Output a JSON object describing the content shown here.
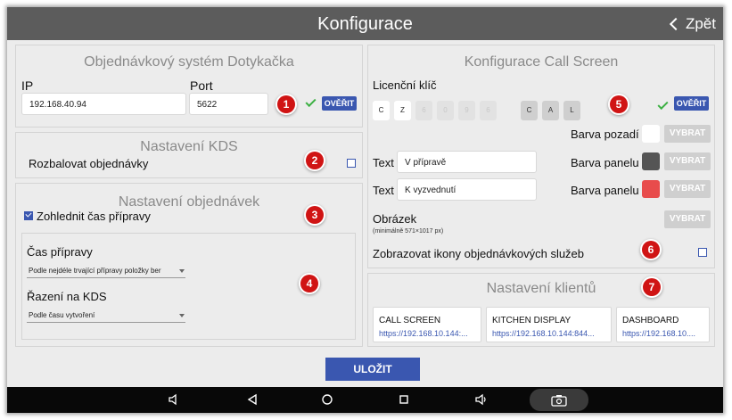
{
  "header": {
    "title": "Konfigurace",
    "back_label": "Zpět"
  },
  "dotykacka": {
    "title": "Objednávkový systém Dotykačka",
    "ip_label": "IP",
    "ip_value": "192.168.40.94",
    "port_label": "Port",
    "port_value": "5622",
    "verify_label": "OVĚŘIT",
    "badge": "1"
  },
  "kds": {
    "title": "Nastavení KDS",
    "expand_label": "Rozbalovat objednávky",
    "badge": "2"
  },
  "orders": {
    "title": "Nastavení objednávek",
    "prep_time_label": "Zohlednit čas přípravy",
    "badge": "3",
    "badge_selects": "4",
    "prep_time_select_label": "Čas přípravy",
    "prep_time_select_value": "Podle nejdéle trvající přípravy položky ber",
    "sort_label": "Řazení na KDS",
    "sort_value": "Podle času vytvoření"
  },
  "callscreen": {
    "title": "Konfigurace Call Screen",
    "license_label": "Licenční klíč",
    "license_keys": [
      "C",
      "Z",
      "6",
      "0",
      "9",
      "6",
      "C",
      "A",
      "L"
    ],
    "verify_label": "OVĚŘIT",
    "badge": "5",
    "bg_color_label": "Barva pozadí",
    "panel_color_label": "Barva panelu",
    "choose_label": "VYBRAT",
    "text_label": "Text",
    "text1_value": "V přípravě",
    "text2_value": "K vyzvednutí",
    "image_label": "Obrázek",
    "image_hint": "(minimálně 571×1017 px)",
    "show_icons_label": "Zobrazovat ikony objednávkových služeb",
    "badge_icons": "6",
    "colors": {
      "background": "#ffffff",
      "panel1": "#555555",
      "panel2": "#e84c4c"
    }
  },
  "clients": {
    "title": "Nastavení klientů",
    "badge": "7",
    "items": [
      {
        "name": "CALL SCREEN",
        "url": "https://192.168.10.144:..."
      },
      {
        "name": "KITCHEN DISPLAY",
        "url": "https://192.168.10.144:844..."
      },
      {
        "name": "DASHBOARD",
        "url": "https://192.168.10...."
      }
    ]
  },
  "save_label": "ULOŽIT"
}
